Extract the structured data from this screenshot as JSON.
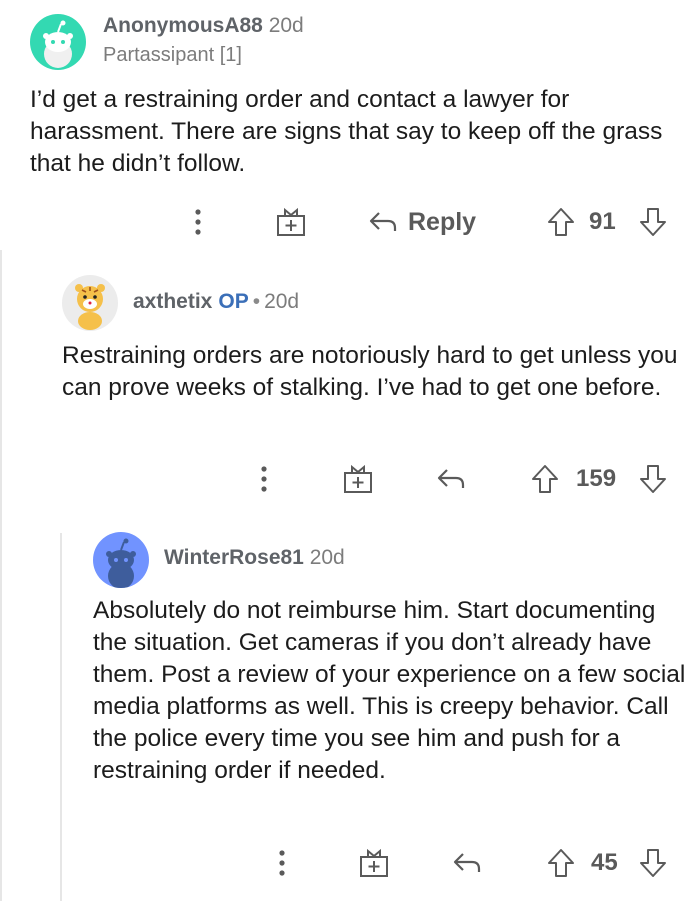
{
  "comments": [
    {
      "username": "AnonymousA88",
      "age": "20d",
      "flair": "Partassipant [1]",
      "is_op": false,
      "op_label": "",
      "body": "I’d get a restraining order and contact a lawyer for harassment. There are signs that say to keep off the grass that he didn’t follow.",
      "reply_label": "Reply",
      "score": "91",
      "avatar_color": "#33d9b2"
    },
    {
      "username": "axthetix",
      "age": "20d",
      "flair": "",
      "is_op": true,
      "op_label": "OP",
      "separator": "•",
      "body": "Restraining orders are notoriously hard to get unless you can prove weeks of stalking. I’ve had to get one before.",
      "reply_label": "",
      "score": "159",
      "avatar_color": "#f5c04a"
    },
    {
      "username": "WinterRose81",
      "age": "20d",
      "flair": "",
      "is_op": false,
      "op_label": "",
      "body": "Absolutely do not reimburse him. Start documenting the situation. Get cameras if you don’t already have them. Post a review of your experience on a few social media platforms as well. This is creepy behavior. Call the police every time you see him and push for a restraining order if needed.",
      "reply_label": "",
      "score": "45",
      "avatar_color": "#7193ff"
    }
  ],
  "colors": {
    "text": "#1c1c1c",
    "username": "#5f6368",
    "muted": "#7c7c7c",
    "op": "#3b6fb8",
    "thread_line": "#e6e6e6"
  },
  "icons": [
    "more-icon",
    "award-icon",
    "reply-icon",
    "upvote-icon",
    "downvote-icon"
  ]
}
